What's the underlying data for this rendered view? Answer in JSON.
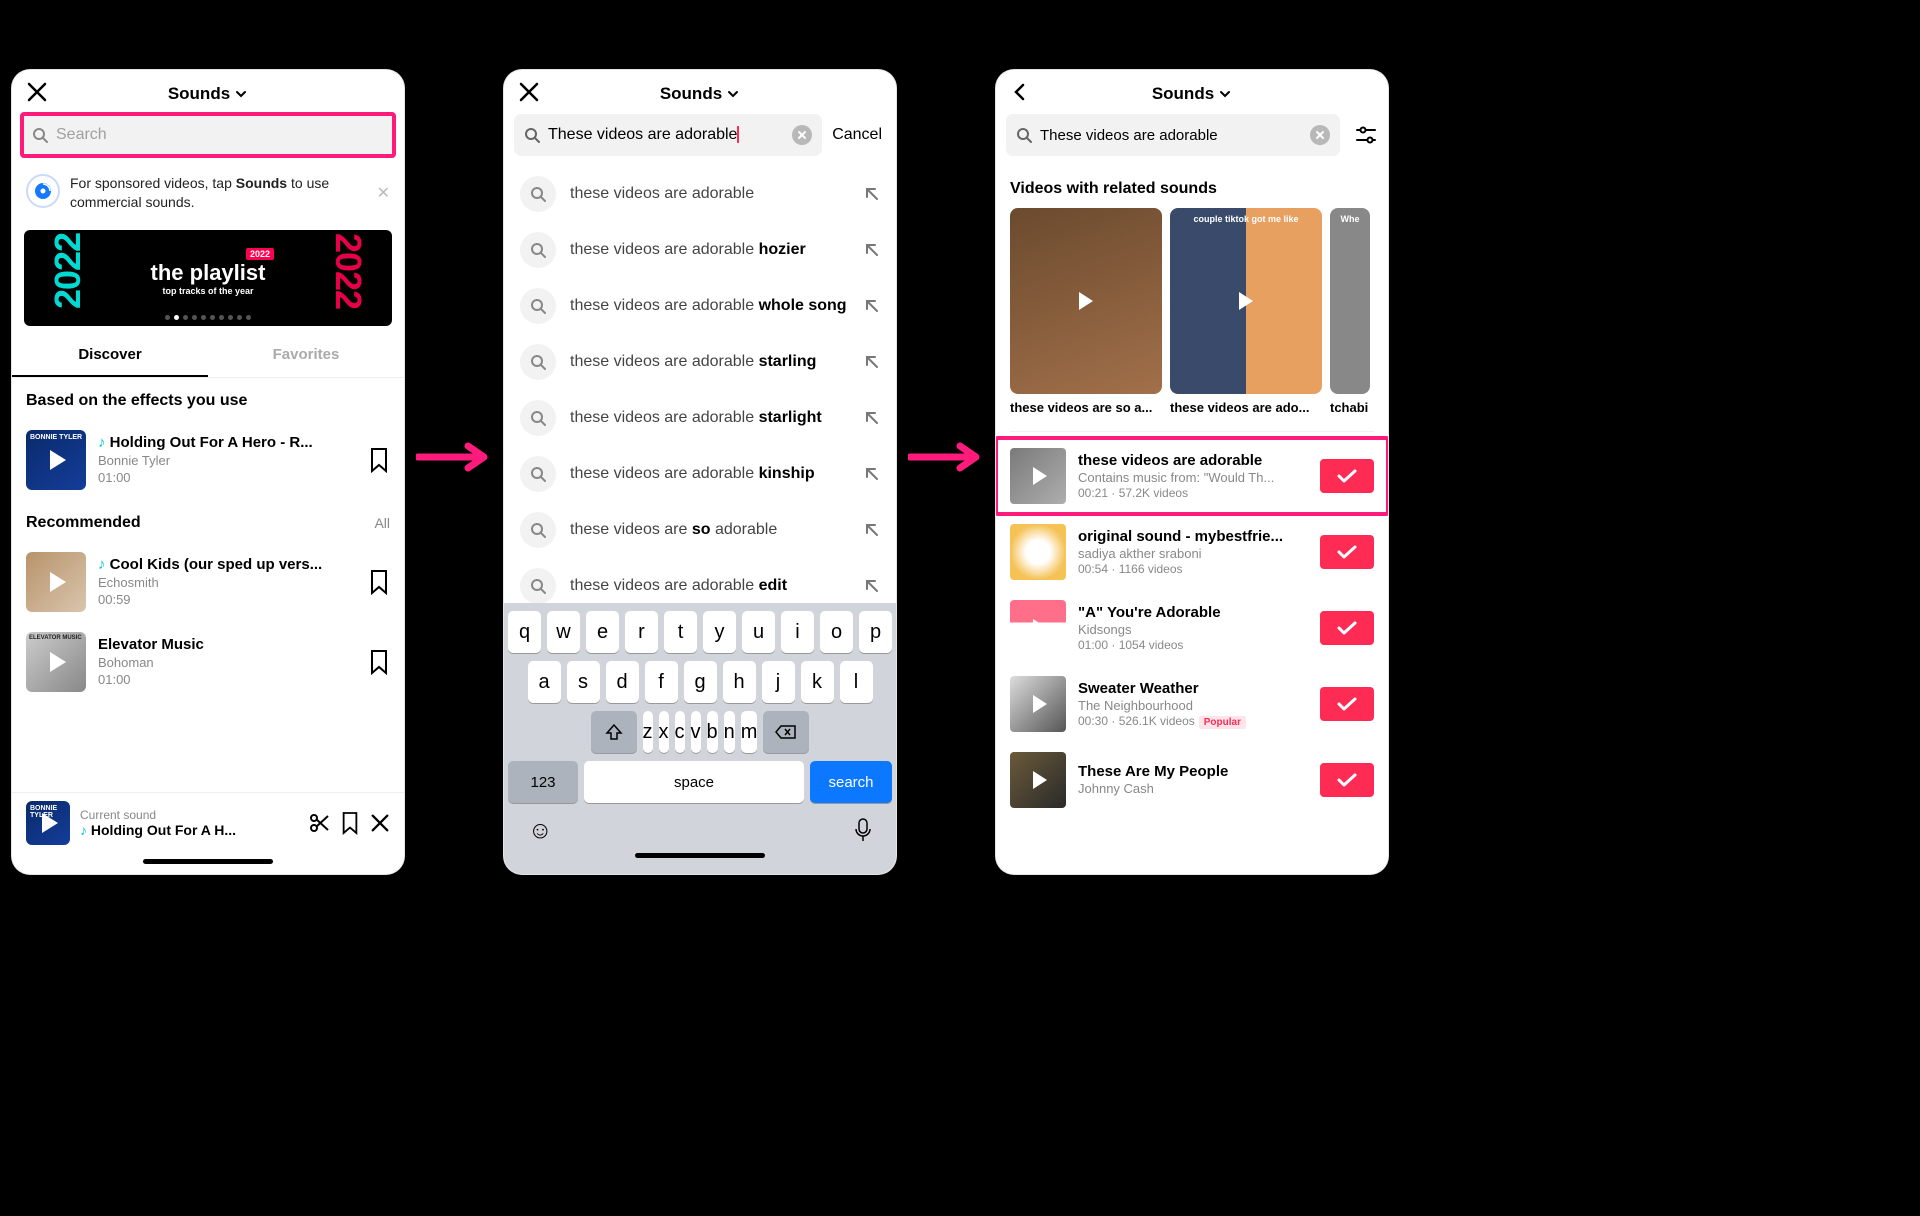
{
  "header": {
    "title": "Sounds"
  },
  "search": {
    "placeholder": "Search",
    "query": "These videos are adorable",
    "cancel_label": "Cancel"
  },
  "tip": {
    "text_pre": "For sponsored videos, tap ",
    "text_bold": "Sounds",
    "text_post": " to use commercial sounds."
  },
  "banner": {
    "year": "2022",
    "badge": "2022",
    "title": "the playlist",
    "subtitle": "top tracks of the year"
  },
  "tabs": {
    "discover": "Discover",
    "favorites": "Favorites"
  },
  "sections": {
    "effects": "Based on the effects you use",
    "recommended": "Recommended",
    "all": "All"
  },
  "effects_sound": {
    "title": "Holding Out For A Hero - R...",
    "artist": "Bonnie Tyler",
    "duration": "01:00"
  },
  "recommended": [
    {
      "title": "Cool Kids (our sped up vers...",
      "artist": "Echosmith",
      "duration": "00:59"
    },
    {
      "title": "Elevator Music",
      "artist": "Bohoman",
      "duration": "01:00"
    }
  ],
  "player": {
    "label": "Current sound",
    "title": "Holding Out For A H..."
  },
  "suggestions": [
    {
      "pre": "these videos are adorable",
      "bold": ""
    },
    {
      "pre": "these videos are adorable ",
      "bold": "hozier"
    },
    {
      "pre": "these videos are adorable ",
      "bold": "whole song"
    },
    {
      "pre": "these videos are adorable ",
      "bold": "starling"
    },
    {
      "pre": "these videos are adorable ",
      "bold": "starlight"
    },
    {
      "pre": "these videos are adorable ",
      "bold": "kinship"
    },
    {
      "pre": "these videos are ",
      "bold": "so",
      "post": " adorable"
    },
    {
      "pre": "these videos are adorable ",
      "bold": "edit"
    }
  ],
  "keyboard": {
    "row1": [
      "q",
      "w",
      "e",
      "r",
      "t",
      "y",
      "u",
      "i",
      "o",
      "p"
    ],
    "row2": [
      "a",
      "s",
      "d",
      "f",
      "g",
      "h",
      "j",
      "k",
      "l"
    ],
    "row3": [
      "z",
      "x",
      "c",
      "v",
      "b",
      "n",
      "m"
    ],
    "numbers": "123",
    "space": "space",
    "search": "search"
  },
  "results": {
    "section": "Videos with related sounds",
    "videos": [
      {
        "caption": "",
        "title": "these videos are so a..."
      },
      {
        "caption": "couple tiktok got me like",
        "title": "these videos are ado..."
      },
      {
        "caption": "Whe",
        "title": "tchabi"
      }
    ],
    "sounds": [
      {
        "title": "these videos are adorable",
        "sub": "Contains music from: \"Would Th...",
        "meta": "00:21 · 57.2K videos",
        "highlight": true
      },
      {
        "title": "original sound - mybestfrie...",
        "sub": "sadiya akther sraboni",
        "meta": "00:54 · 1166 videos"
      },
      {
        "title": "\"A\" You're Adorable",
        "sub": "Kidsongs",
        "meta": "01:00 · 1054 videos"
      },
      {
        "title": "Sweater Weather",
        "sub": "The Neighbourhood",
        "meta": "00:30 · 526.1K videos",
        "popular": "Popular"
      },
      {
        "title": "These Are My People",
        "sub": "Johnny Cash",
        "meta": ""
      }
    ]
  }
}
